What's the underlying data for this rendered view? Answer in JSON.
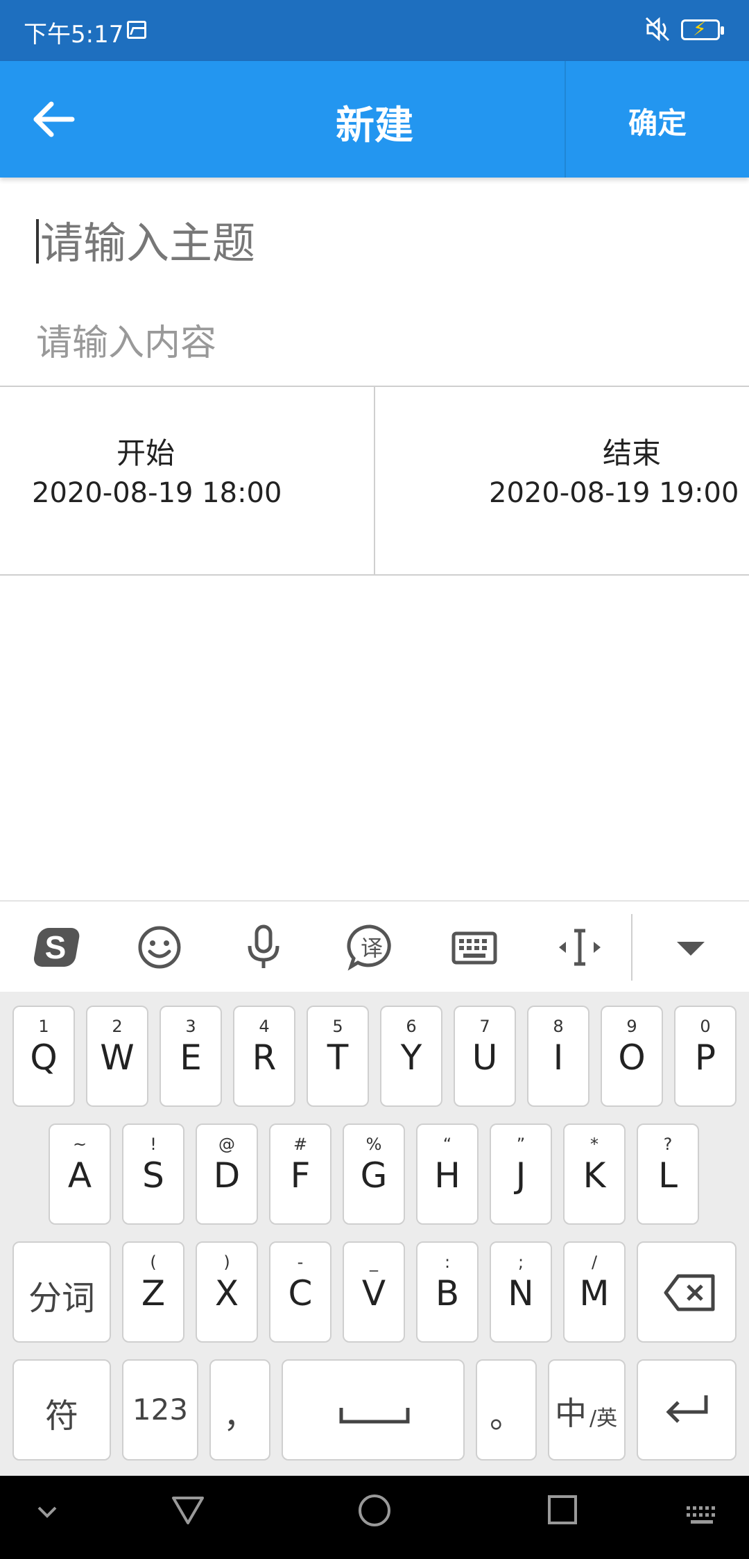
{
  "status_bar": {
    "time": "下午5:17",
    "icons": [
      "image-icon",
      "mute-icon",
      "battery-charging-icon"
    ]
  },
  "app_bar": {
    "title": "新建",
    "confirm_label": "确定",
    "back_icon": "arrow-left-icon",
    "bg_color": "#2396f0"
  },
  "form": {
    "subject_placeholder": "请输入主题",
    "content_placeholder": "请输入内容",
    "start": {
      "label": "开始",
      "datetime": "2020-08-19 18:00"
    },
    "end": {
      "label": "结束",
      "datetime": "2020-08-19 19:00"
    }
  },
  "keyboard": {
    "toolbar": [
      "sogou-logo-icon",
      "emoji-icon",
      "microphone-icon",
      "translate-icon",
      "keyboard-icon",
      "cursor-icon",
      "collapse-icon"
    ],
    "translate_glyph": "译",
    "row1": [
      {
        "main": "Q",
        "sub": "1"
      },
      {
        "main": "W",
        "sub": "2"
      },
      {
        "main": "E",
        "sub": "3"
      },
      {
        "main": "R",
        "sub": "4"
      },
      {
        "main": "T",
        "sub": "5"
      },
      {
        "main": "Y",
        "sub": "6"
      },
      {
        "main": "U",
        "sub": "7"
      },
      {
        "main": "I",
        "sub": "8"
      },
      {
        "main": "O",
        "sub": "9"
      },
      {
        "main": "P",
        "sub": "0"
      }
    ],
    "row2": [
      {
        "main": "A",
        "sub": "~"
      },
      {
        "main": "S",
        "sub": "!"
      },
      {
        "main": "D",
        "sub": "@"
      },
      {
        "main": "F",
        "sub": "#"
      },
      {
        "main": "G",
        "sub": "%"
      },
      {
        "main": "H",
        "sub": "“"
      },
      {
        "main": "J",
        "sub": "”"
      },
      {
        "main": "K",
        "sub": "*"
      },
      {
        "main": "L",
        "sub": "?"
      }
    ],
    "row3": [
      {
        "main": "Z",
        "sub": "("
      },
      {
        "main": "X",
        "sub": ")"
      },
      {
        "main": "C",
        "sub": "-"
      },
      {
        "main": "V",
        "sub": "_"
      },
      {
        "main": "B",
        "sub": ":"
      },
      {
        "main": "N",
        "sub": ";"
      },
      {
        "main": "M",
        "sub": "/"
      }
    ],
    "segment_label": "分词",
    "symbol_label": "符",
    "numeric_label": "123",
    "comma_label": "，",
    "period_label": "。",
    "lang_label_main": "中",
    "lang_label_sub": "/英"
  },
  "nav_bar": {
    "icons": [
      "chevron-down-icon",
      "back-triangle-icon",
      "home-circle-icon",
      "recents-square-icon",
      "keyboard-grid-icon"
    ]
  }
}
